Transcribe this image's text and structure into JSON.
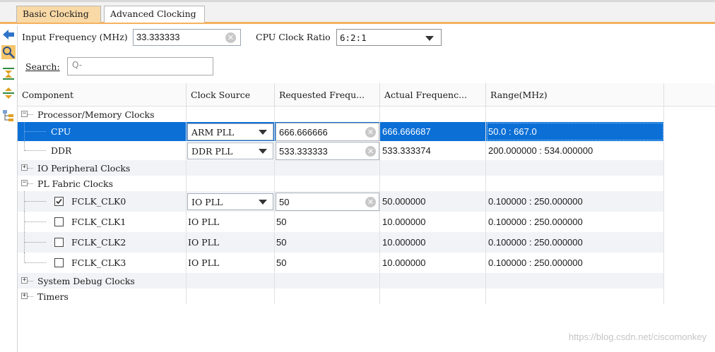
{
  "tabs": [
    {
      "label": "Basic Clocking",
      "active": true
    },
    {
      "label": "Advanced Clocking",
      "active": false
    }
  ],
  "form": {
    "input_freq_label": "Input Frequency (MHz)",
    "input_freq_value": "33.333333",
    "cpu_ratio_label": "CPU Clock Ratio",
    "cpu_ratio_value": "6:2:1",
    "search_label": "Search:",
    "search_placeholder": "Q-"
  },
  "toolbar": {
    "icons": [
      "back-arrow-icon",
      "search-icon",
      "collapse-all-icon",
      "expand-all-icon",
      "hierarchy-icon"
    ]
  },
  "table": {
    "headers": [
      "Component",
      "Clock Source",
      "Requested Frequ...",
      "Actual Frequenc...",
      "Range(MHz)"
    ],
    "groups": {
      "processor": "Processor/Memory Clocks",
      "io": "IO Peripheral Clocks",
      "pl": "PL Fabric Clocks",
      "debug": "System Debug Clocks",
      "timers": "Timers"
    },
    "rows": {
      "cpu": {
        "name": "CPU",
        "source": "ARM PLL",
        "requested": "666.666666",
        "actual": "666.666687",
        "range": "50.0 : 667.0"
      },
      "ddr": {
        "name": "DDR",
        "source": "DDR PLL",
        "requested": "533.333333",
        "actual": "533.333374",
        "range": "200.000000 : 534.000000"
      },
      "fclk0": {
        "name": "FCLK_CLK0",
        "source": "IO PLL",
        "requested": "50",
        "actual": "50.000000",
        "range": "0.100000 : 250.000000",
        "checked": true
      },
      "fclk1": {
        "name": "FCLK_CLK1",
        "source": "IO PLL",
        "requested": "50",
        "actual": "10.000000",
        "range": "0.100000 : 250.000000",
        "checked": false
      },
      "fclk2": {
        "name": "FCLK_CLK2",
        "source": "IO PLL",
        "requested": "50",
        "actual": "10.000000",
        "range": "0.100000 : 250.000000",
        "checked": false
      },
      "fclk3": {
        "name": "FCLK_CLK3",
        "source": "IO PLL",
        "requested": "50",
        "actual": "10.000000",
        "range": "0.100000 : 250.000000",
        "checked": false
      }
    }
  },
  "watermark": "https://blog.csdn.net/ciscomonkey",
  "colors": {
    "tab_accent": "#f5b260",
    "selection": "#0b6fd6"
  }
}
